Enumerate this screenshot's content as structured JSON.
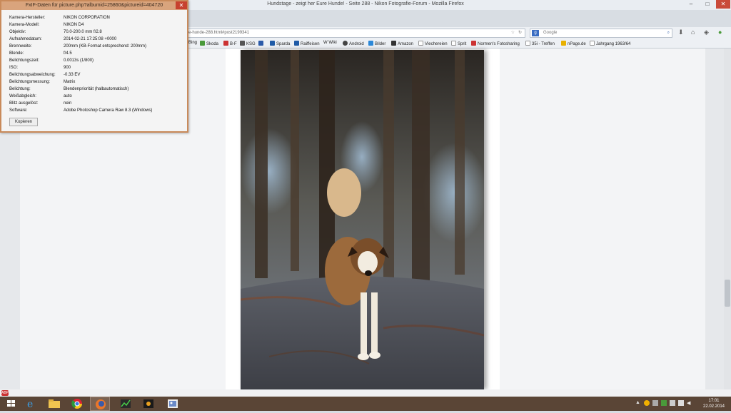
{
  "window": {
    "title": "Hundstage - zeigt her Eure Hunde! - Seite 288 - Nikon Fotografie-Forum - Mozilla Firefox",
    "minimize": "–",
    "maximize": "□",
    "close": "✕"
  },
  "navbar": {
    "url": "ve-hunde-288.html#post2199341",
    "search_placeholder": "Google",
    "search_engine_icon": "g-icon"
  },
  "bookmarks": [
    {
      "label": "Bing",
      "color": "#2b88d8"
    },
    {
      "label": "Skoda",
      "color": "#4a9a3a"
    },
    {
      "label": "B-F",
      "color": "#c33"
    },
    {
      "label": "KSG",
      "color": "#555"
    },
    {
      "label": "",
      "color": "#2b5aa8"
    },
    {
      "label": "Sparda",
      "color": "#1f5aa6"
    },
    {
      "label": "Raiffeisen",
      "color": "#1f5aa6"
    },
    {
      "label": "Wiki",
      "color": "#777"
    },
    {
      "label": "Android",
      "color": "#444"
    },
    {
      "label": "Bilder",
      "color": "#2b88d8"
    },
    {
      "label": "Amazon",
      "color": "#333"
    },
    {
      "label": "Viechereien",
      "color": "#ddd"
    },
    {
      "label": "Sprit",
      "color": "#ddd"
    },
    {
      "label": "Normen's Fotosharing",
      "color": "#c33"
    },
    {
      "label": "35i - Treffen",
      "color": "#ddd"
    },
    {
      "label": "nPage.de",
      "color": "#e8b000"
    },
    {
      "label": "Jahrgang 1963/64",
      "color": "#ddd"
    }
  ],
  "exif": {
    "title": "FxIF-Daten für picture.php?albumid=25860&pictureid=404720",
    "close": "✕",
    "rows": [
      {
        "key": "Kamera-Hersteller:",
        "value": "NIKON CORPORATION"
      },
      {
        "key": "Kamera-Modell:",
        "value": "NIKON D4"
      },
      {
        "key": "Objektiv:",
        "value": "70.0-200.0 mm f/2.8"
      },
      {
        "key": "Aufnahmedatum:",
        "value": "2014-02-21 17:25:08 +0000"
      },
      {
        "key": "Brennweite:",
        "value": "200mm (KB-Format entsprechend: 200mm)"
      },
      {
        "key": "Blende:",
        "value": "f/4.5"
      },
      {
        "key": "Belichtungszeit:",
        "value": "0.0013s (1/800)"
      },
      {
        "key": "ISO:",
        "value": "900"
      },
      {
        "key": "Belichtungsabweichung:",
        "value": "-0.33 EV"
      },
      {
        "key": "Belichtungsmessung:",
        "value": "Matrix"
      },
      {
        "key": "Belichtung:",
        "value": "Blendenpriorität (halbautomatisch)"
      },
      {
        "key": "Weißabgleich:",
        "value": "auto"
      },
      {
        "key": "Blitz ausgelöst:",
        "value": "nein"
      },
      {
        "key": "Software:",
        "value": "Adobe Photoshop Camera Raw 8.3 (Windows)"
      }
    ],
    "copy_button": "Kopieren"
  },
  "taskbar": {
    "time": "17:01",
    "date": "22.02.2014",
    "apps": [
      "windows-start-icon",
      "internet-explorer-icon",
      "file-explorer-icon",
      "chrome-icon",
      "firefox-icon",
      "chart-app-icon",
      "camera-app-icon",
      "photo-viewer-icon"
    ]
  }
}
